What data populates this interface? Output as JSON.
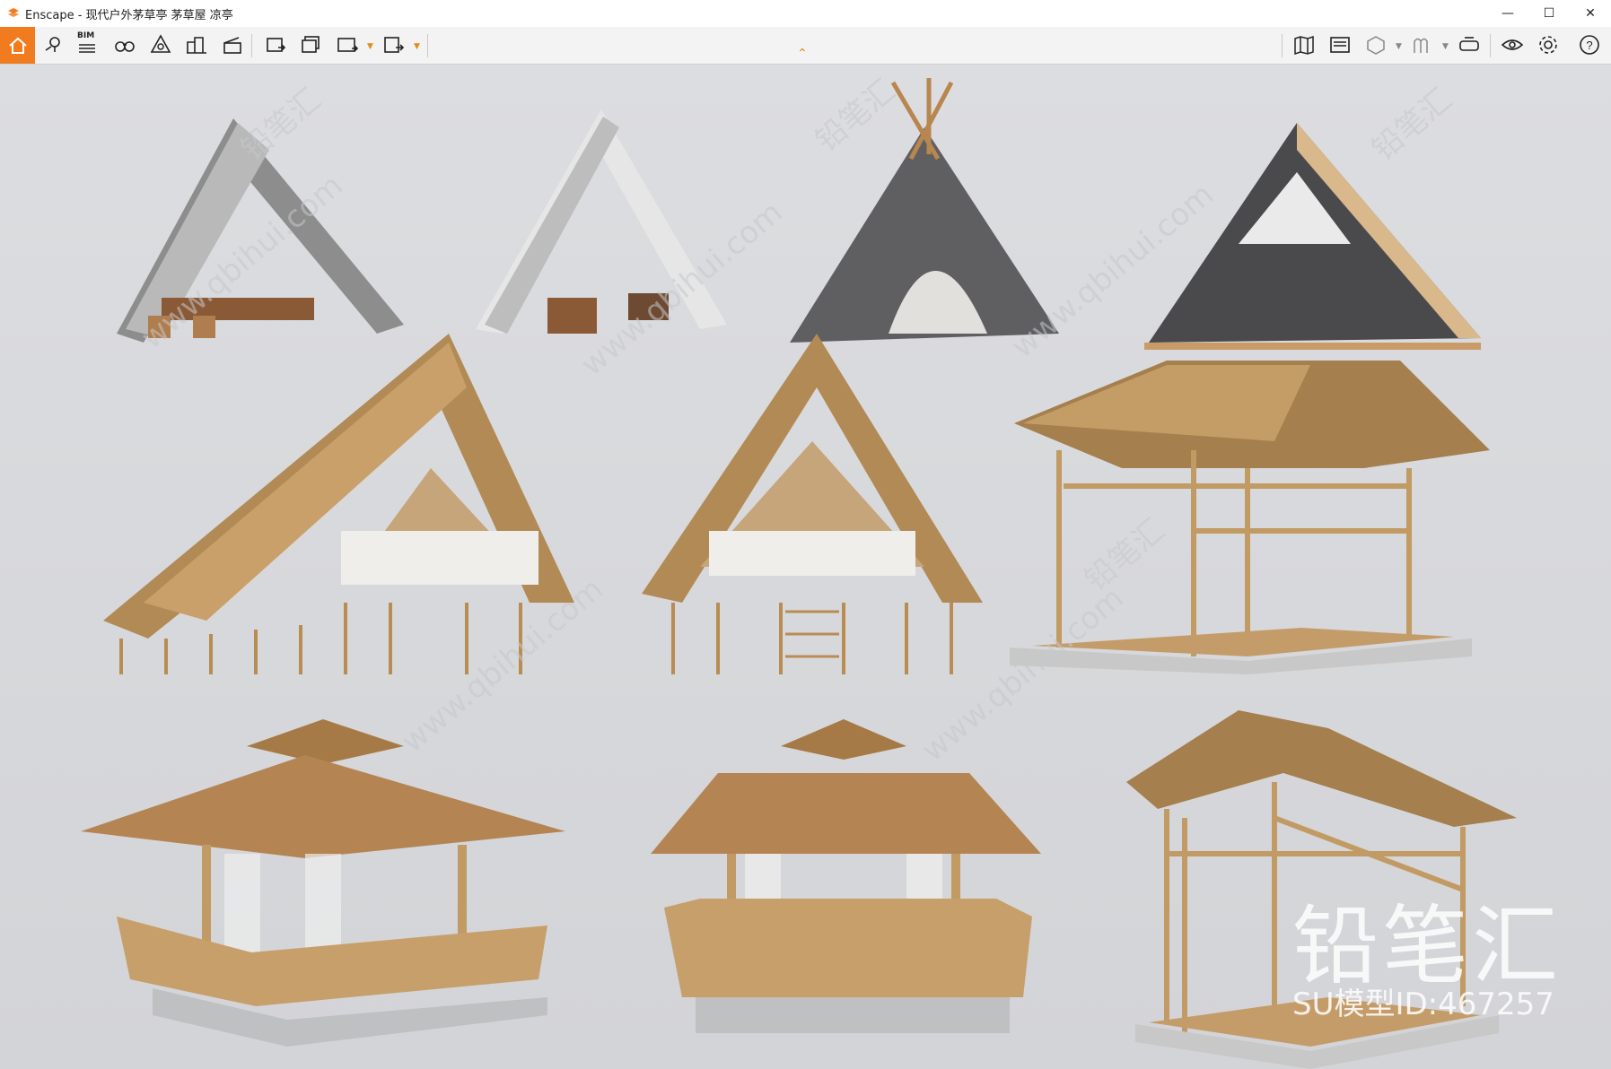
{
  "window": {
    "title": "Enscape - 现代户外茅草亭 茅草屋 凉亭",
    "minimize_symbol": "—",
    "maximize_symbol": "☐",
    "close_symbol": "✕"
  },
  "toolbar": {
    "bim_label": "BIM",
    "icons": [
      "home-icon",
      "location-pin-icon",
      "bim-list-icon",
      "binoculars-icon",
      "asset-library-icon",
      "buildings-icon",
      "clapper-icon",
      "render-image-icon",
      "batch-render-icon",
      "panorama-360-icon",
      "export-exe-icon",
      "map-icon",
      "site-context-icon",
      "cube-view-icon",
      "material-editor-icon",
      "vr-headset-icon",
      "visibility-icon",
      "settings-gear-icon",
      "help-icon"
    ],
    "accent_color": "#f07c1f"
  },
  "watermark": {
    "brand": "铅笔汇",
    "model_id": "SU模型ID:467257",
    "url_text": "www.qbihui.com"
  }
}
